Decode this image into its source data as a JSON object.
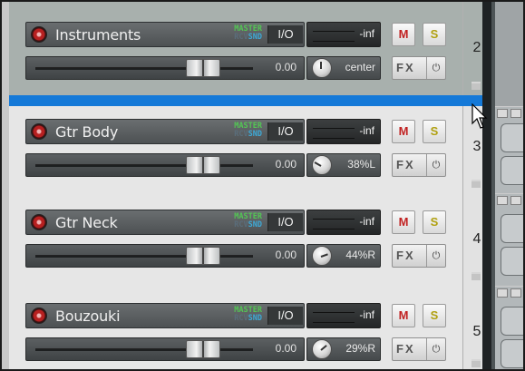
{
  "tracks": [
    {
      "name": "Instruments",
      "number": "2",
      "meter": "-inf",
      "volume": "0.00",
      "pan": "center",
      "pan_angle": 0,
      "route_master": "MASTER",
      "route_rcv": "RCV",
      "route_snd": "SND",
      "io": "I/O",
      "mute": "M",
      "solo": "S",
      "fx": "FX",
      "power": "⏻"
    },
    {
      "name": "Gtr Body",
      "number": "3",
      "meter": "-inf",
      "volume": "0.00",
      "pan": "38%L",
      "pan_angle": -60,
      "route_master": "MASTER",
      "route_rcv": "RCV",
      "route_snd": "SND",
      "io": "I/O",
      "mute": "M",
      "solo": "S",
      "fx": "FX",
      "power": "⏻"
    },
    {
      "name": "Gtr Neck",
      "number": "4",
      "meter": "-inf",
      "volume": "0.00",
      "pan": "44%R",
      "pan_angle": 70,
      "route_master": "MASTER",
      "route_rcv": "RCV",
      "route_snd": "SND",
      "io": "I/O",
      "mute": "M",
      "solo": "S",
      "fx": "FX",
      "power": "⏻"
    },
    {
      "name": "Bouzouki",
      "number": "5",
      "meter": "-inf",
      "volume": "0.00",
      "pan": "29%R",
      "pan_angle": 50,
      "route_master": "MASTER",
      "route_rcv": "RCV",
      "route_snd": "SND",
      "io": "I/O",
      "mute": "M",
      "solo": "S",
      "fx": "FX",
      "power": "⏻"
    }
  ],
  "colors": {
    "drop_indicator": "#1479d8",
    "record_arm": "#b72020",
    "route_master": "#53c654",
    "route_send": "#3da9d6"
  }
}
